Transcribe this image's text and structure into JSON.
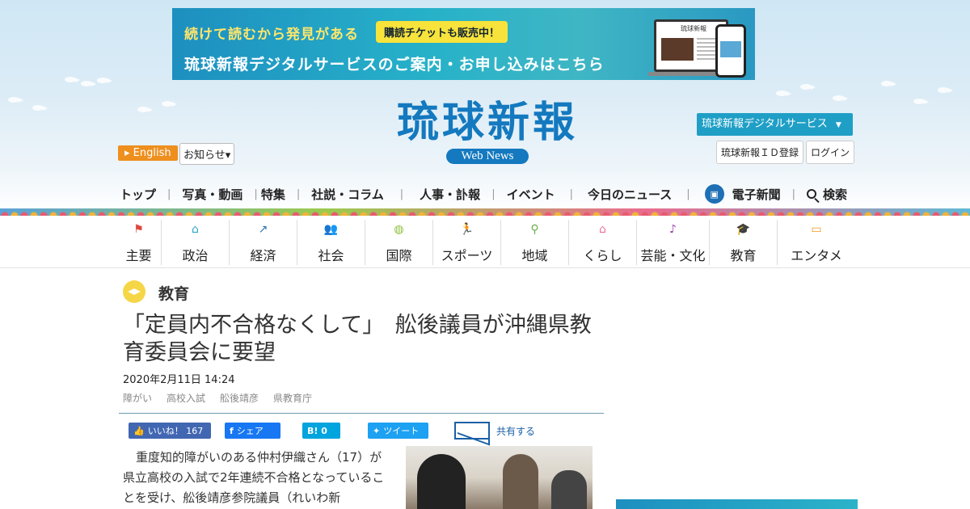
{
  "banner": {
    "line1": "続けて読むから発見がある",
    "badge": "購読チケットも販売中！",
    "line2": "琉球新報デジタルサービスのご案内・お申し込みはこちら",
    "laptop_logo": "琉球新報"
  },
  "header": {
    "logo_title": "琉球新報",
    "logo_sub": "Web News",
    "english": "English",
    "notice": "お知らせ▾",
    "digital_service": "琉球新報デジタルサービス",
    "id_register": "琉球新報ＩＤ登録",
    "login": "ログイン"
  },
  "main_nav": {
    "items": [
      "トップ",
      "写真・動画",
      "特集",
      "社説・コラム",
      "人事・訃報",
      "イベント",
      "今日のニュース",
      "電子新聞",
      "検索"
    ]
  },
  "categories": [
    {
      "label": "主要",
      "icon": "flag-icon",
      "color": "#e0463f",
      "glyph": "⚑"
    },
    {
      "label": "政治",
      "icon": "building-icon",
      "color": "#2aa6c7",
      "glyph": "⌂"
    },
    {
      "label": "経済",
      "icon": "chart-icon",
      "color": "#2d6fb3",
      "glyph": "↗"
    },
    {
      "label": "社会",
      "icon": "people-icon",
      "color": "#3b7fc8",
      "glyph": "👥"
    },
    {
      "label": "国際",
      "icon": "globe-icon",
      "color": "#8cbf3a",
      "glyph": "◍"
    },
    {
      "label": "スポーツ",
      "icon": "runner-icon",
      "color": "#e8466a",
      "glyph": "🏃"
    },
    {
      "label": "地域",
      "icon": "pin-icon",
      "color": "#6ab04c",
      "glyph": "⚲"
    },
    {
      "label": "くらし",
      "icon": "home-icon",
      "color": "#ef6fa0",
      "glyph": "⌂"
    },
    {
      "label": "芸能・文化",
      "icon": "sanshin-icon",
      "color": "#9b3fb0",
      "glyph": "♪"
    },
    {
      "label": "教育",
      "icon": "graduation-cap-icon",
      "color": "#f0c531",
      "glyph": "🎓"
    },
    {
      "label": "エンタメ",
      "icon": "tv-icon",
      "color": "#f39a1e",
      "glyph": "▭"
    }
  ],
  "article": {
    "category": "教育",
    "headline": "「定員内不合格なくして」　舩後議員が沖縄県教育委員会に要望",
    "date": "2020年2月11日 14:24",
    "tags": [
      "障がい",
      "高校入試",
      "舩後靖彦",
      "県教育庁"
    ],
    "body": "重度知的障がいのある仲村伊織さん（17）が県立高校の入試で2年連続不合格となっていることを受け、舩後靖彦参院議員（れいわ新"
  },
  "share": {
    "like": "いいね！ 167",
    "fb_share": "シェア",
    "hatena": "B!  0",
    "tweet": "ツイート",
    "share_label": "共有する"
  }
}
